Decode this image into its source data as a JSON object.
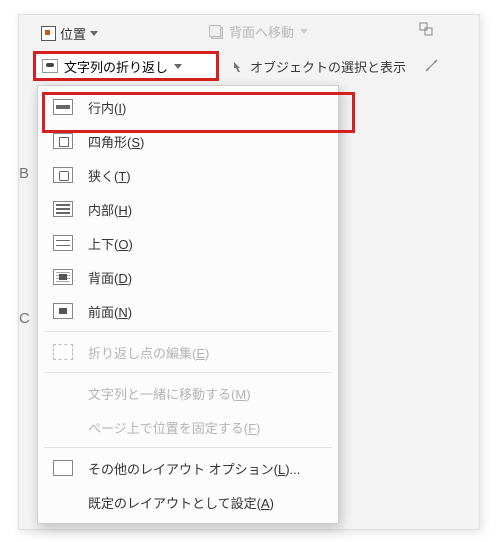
{
  "ribbon": {
    "position_label": "位置",
    "send_back_label": "背面へ移動",
    "wrap_button_label": "文字列の折り返し",
    "selection_pane_label": "オブジェクトの選択と表示"
  },
  "menu": {
    "inline": "行内(I)",
    "square": "四角形(S)",
    "tight": "狭く(T)",
    "through": "内部(H)",
    "topbottom": "上下(O)",
    "behind": "背面(D)",
    "front": "前面(N)",
    "edit_points": "折り返し点の編集(E)",
    "move_with_text": "文字列と一緒に移動する(M)",
    "fix_on_page": "ページ上で位置を固定する(F)",
    "more_layout": "その他のレイアウト オプション(L)...",
    "set_default": "既定のレイアウトとして設定(A)"
  },
  "edge": {
    "b": "B",
    "c": "C"
  }
}
